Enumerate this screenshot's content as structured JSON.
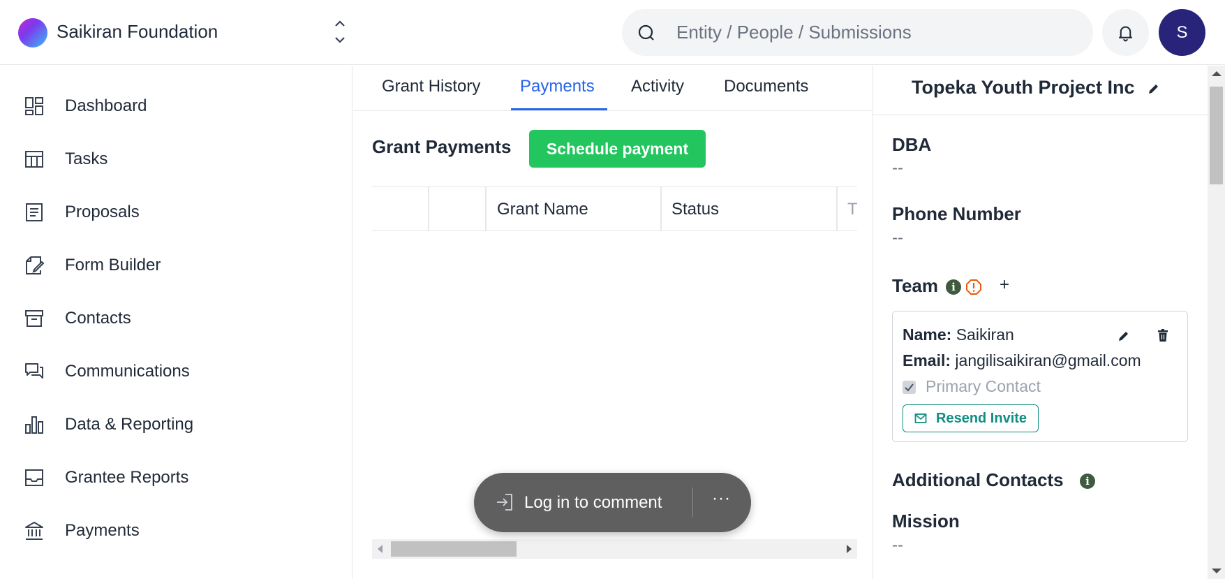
{
  "header": {
    "org_name": "Saikiran Foundation",
    "search_placeholder": "Entity / People / Submissions",
    "avatar_initial": "S"
  },
  "sidebar": {
    "items": [
      {
        "label": "Dashboard",
        "icon": "dashboard-icon"
      },
      {
        "label": "Tasks",
        "icon": "table-icon"
      },
      {
        "label": "Proposals",
        "icon": "document-icon"
      },
      {
        "label": "Form Builder",
        "icon": "form-edit-icon"
      },
      {
        "label": "Contacts",
        "icon": "archive-box-icon"
      },
      {
        "label": "Communications",
        "icon": "chat-bubbles-icon"
      },
      {
        "label": "Data & Reporting",
        "icon": "bar-chart-icon"
      },
      {
        "label": "Grantee Reports",
        "icon": "inbox-tray-icon"
      },
      {
        "label": "Payments",
        "icon": "bank-icon"
      }
    ]
  },
  "tabs": [
    {
      "label": "Grant History",
      "active": false
    },
    {
      "label": "Payments",
      "active": true
    },
    {
      "label": "Activity",
      "active": false
    },
    {
      "label": "Documents",
      "active": false
    }
  ],
  "payments": {
    "title": "Grant Payments",
    "schedule_button": "Schedule payment",
    "columns": [
      "",
      "",
      "Grant Name",
      "Status",
      "T"
    ]
  },
  "comment_bar": {
    "login_label": "Log in to comment",
    "more_label": "···"
  },
  "entity": {
    "name": "Topeka Youth Project Inc",
    "dba_label": "DBA",
    "dba_value": "--",
    "phone_label": "Phone Number",
    "phone_value": "--",
    "team_label": "Team",
    "add_label": "+",
    "team_member": {
      "name_label": "Name:",
      "name_value": "Saikiran",
      "email_label": "Email:",
      "email_value": "jangilisaikiran@gmail.com",
      "primary_label": "Primary Contact",
      "resend_label": "Resend Invite"
    },
    "additional_contacts_label": "Additional Contacts",
    "mission_label": "Mission",
    "mission_value": "--"
  },
  "colors": {
    "accent": "#2563eb",
    "primary_button": "#22c55e",
    "avatar_bg": "#27247a",
    "teal": "#0f8f7f",
    "warning": "#ea580c"
  }
}
